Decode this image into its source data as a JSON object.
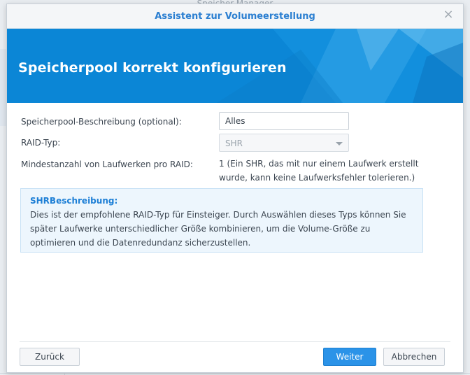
{
  "background": {
    "window_title": "Speicher-Manager"
  },
  "dialog": {
    "title": "Assistent zur Volumeerstellung",
    "close_symbol": "×",
    "banner_heading": "Speicherpool korrekt konfigurieren"
  },
  "form": {
    "description_label": "Speicherpool-Beschreibung (optional):",
    "description_value": "Alles",
    "raid_label": "RAID-Typ:",
    "raid_value": "SHR",
    "min_drives_label": "Mindestanzahl von Laufwerken pro RAID:",
    "min_drives_value": "1 (Ein SHR, das mit nur einem Laufwerk erstellt wurde, kann keine Laufwerksfehler tolerieren.)"
  },
  "info": {
    "title": "SHRBeschreibung:",
    "text": "Dies ist der empfohlene RAID-Typ für Einsteiger. Durch Auswählen dieses Typs können Sie später Laufwerke unterschiedlicher Größe kombinieren, um die Volume-Größe zu optimieren und die Datenredundanz sicherzustellen."
  },
  "footer": {
    "back_label": "Zurück",
    "next_label": "Weiter",
    "cancel_label": "Abbrechen"
  },
  "colors": {
    "accent": "#2b93e8",
    "banner": "#0b86d6",
    "title": "#2b7fd1",
    "info_bg": "#edf6fd"
  }
}
